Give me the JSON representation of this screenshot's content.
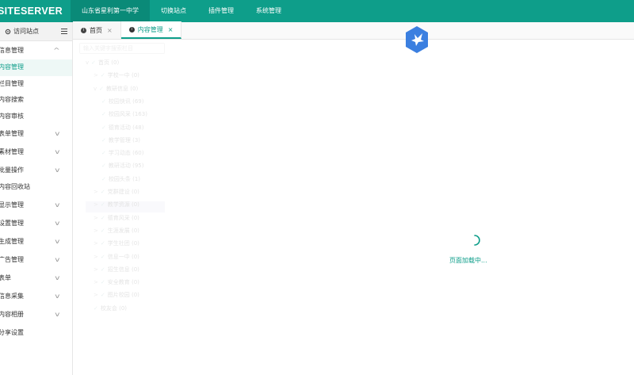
{
  "topbar": {
    "logo": "SITESERVER",
    "nav": [
      {
        "label": "山东省星利第一中学",
        "active": true
      },
      {
        "label": "切换站点",
        "active": false
      },
      {
        "label": "插件管理",
        "active": false
      },
      {
        "label": "系统管理",
        "active": false
      }
    ]
  },
  "sidebar": {
    "visit_label": "访问站点",
    "groups_top": [
      {
        "label": "信息管理",
        "chev": "^"
      }
    ],
    "sub_items": [
      {
        "label": "内容管理",
        "active": true
      },
      {
        "label": "栏目管理",
        "active": false
      },
      {
        "label": "内容搜索",
        "active": false
      },
      {
        "label": "内容审核",
        "active": false
      }
    ],
    "groups_mid": [
      {
        "label": "表单管理",
        "chev": "v"
      },
      {
        "label": "素材管理",
        "chev": "v"
      },
      {
        "label": "批量操作",
        "chev": "v"
      }
    ],
    "recycle": {
      "label": "内容回收站"
    },
    "groups_bottom": [
      {
        "label": "显示管理",
        "chev": "v"
      },
      {
        "label": "设置管理",
        "chev": "v"
      },
      {
        "label": "生成管理",
        "chev": "v"
      },
      {
        "label": "广告管理",
        "chev": "v"
      },
      {
        "label": "表单",
        "chev": "v"
      },
      {
        "label": "信息采集",
        "chev": "v"
      },
      {
        "label": "内容相册",
        "chev": "v"
      },
      {
        "label": "分享设置",
        "chev": ""
      }
    ]
  },
  "tabs": [
    {
      "label": "首页",
      "close": "×",
      "active": false
    },
    {
      "label": "内容管理",
      "close": "×",
      "active": true
    }
  ],
  "content": {
    "search_placeholder": "输入关键字搜索栏目",
    "tree": [
      {
        "label": "首页 (0)",
        "level": 0,
        "caret": "v"
      },
      {
        "label": "学校一中 (0)",
        "level": 1,
        "caret": ">"
      },
      {
        "label": "教研信息 (0)",
        "level": 1,
        "caret": "v"
      },
      {
        "label": "校园快讯 (69)",
        "level": 2,
        "caret": ""
      },
      {
        "label": "校园风采 (163)",
        "level": 2,
        "caret": ""
      },
      {
        "label": "德育活动 (48)",
        "level": 2,
        "caret": ""
      },
      {
        "label": "教学管理 (3)",
        "level": 2,
        "caret": ""
      },
      {
        "label": "学习动态 (60)",
        "level": 2,
        "caret": ""
      },
      {
        "label": "教研活动 (95)",
        "level": 2,
        "caret": ""
      },
      {
        "label": "校园头条 (1)",
        "level": 2,
        "caret": ""
      },
      {
        "label": "党群建设 (0)",
        "level": 1,
        "caret": ">"
      },
      {
        "label": "教学资源 (0)",
        "level": 1,
        "caret": ">"
      },
      {
        "label": "德育风采 (0)",
        "level": 1,
        "caret": ">"
      },
      {
        "label": "生涯发展 (0)",
        "level": 1,
        "caret": ">"
      },
      {
        "label": "学生社团 (0)",
        "level": 1,
        "caret": ">"
      },
      {
        "label": "信息一中 (0)",
        "level": 1,
        "caret": ">"
      },
      {
        "label": "招生信息 (0)",
        "level": 1,
        "caret": ">"
      },
      {
        "label": "安全教育 (0)",
        "level": 1,
        "caret": ">"
      },
      {
        "label": "图片校园 (0)",
        "level": 1,
        "caret": ">"
      },
      {
        "label": "校友会 (0)",
        "level": 1,
        "caret": ""
      }
    ],
    "loading_text": "页面加载中..."
  },
  "colors": {
    "brand": "#0e9e8a",
    "brand_dark": "#0a8a78",
    "logo_blue": "#3b7fe0"
  }
}
